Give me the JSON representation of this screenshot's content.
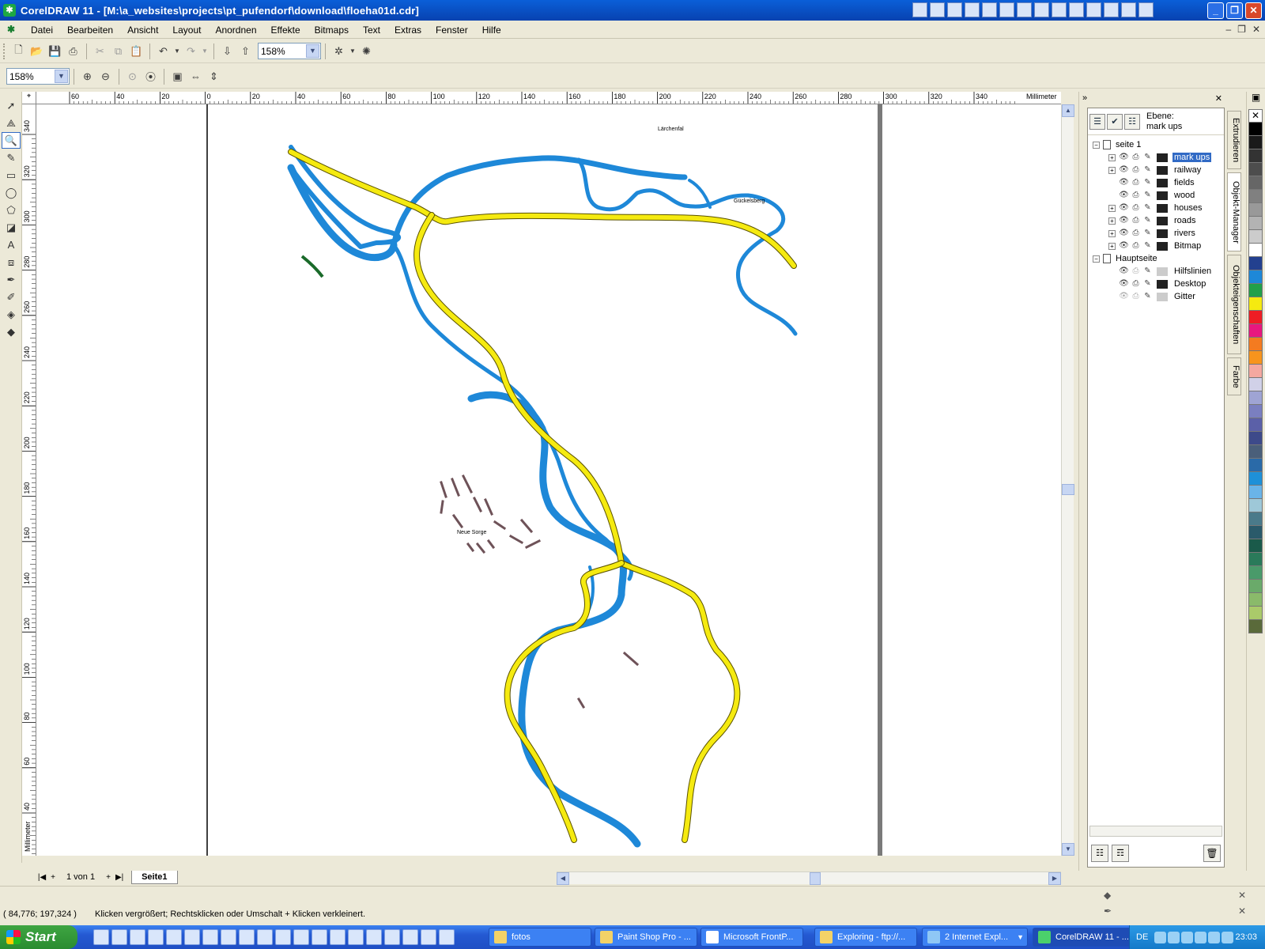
{
  "window": {
    "title": "CorelDRAW 11 - [M:\\a_websites\\projects\\pt_pufendorf\\download\\floeha01d.cdr]",
    "app_icon": "coreldraw-balloon-icon"
  },
  "menu": [
    "Datei",
    "Bearbeiten",
    "Ansicht",
    "Layout",
    "Anordnen",
    "Effekte",
    "Bitmaps",
    "Text",
    "Extras",
    "Fenster",
    "Hilfe"
  ],
  "toolbar": {
    "zoom_standard": "158%",
    "zoom_toolbar": "158%"
  },
  "ruler": {
    "unit": "Millimeter",
    "h_ticks": [
      "60",
      "40",
      "20",
      "0",
      "20",
      "40",
      "60",
      "80",
      "100",
      "120",
      "140",
      "160",
      "180",
      "200",
      "220",
      "240",
      "260",
      "280",
      "300",
      "320",
      "340"
    ],
    "v_ticks": [
      "340",
      "320",
      "300",
      "280",
      "260",
      "240",
      "220",
      "200",
      "180",
      "160",
      "140",
      "120",
      "100",
      "80",
      "60",
      "40"
    ]
  },
  "map_labels": {
    "label1": "Lärchenfal",
    "label2": "Gückelsberg",
    "label3": "Neue Sorge"
  },
  "colors": {
    "river": "#1e88d8",
    "road": "#f5ea10",
    "houses": "#6e5258"
  },
  "page_nav": {
    "count": "1 von 1",
    "tab": "Seite1"
  },
  "docker": {
    "ebene_label": "Ebene:",
    "ebene_value": "mark ups",
    "page": "seite 1",
    "layers": [
      "mark ups",
      "railway",
      "fields",
      "wood",
      "houses",
      "roads",
      "rivers",
      "Bitmap"
    ],
    "master": "Hauptseite",
    "master_layers": [
      "Hilfslinien",
      "Desktop",
      "Gitter"
    ],
    "side_tabs": [
      "Extrudieren",
      "Objekt-Manager",
      "Objekteigenschaften",
      "Farbe"
    ]
  },
  "status": {
    "coords": "( 84,776; 197,324 )",
    "hint": "Klicken vergrößert; Rechtsklicken oder Umschalt + Klicken verkleinert."
  },
  "taskbar": {
    "start": "Start",
    "tasks": [
      "fotos",
      "Paint Shop Pro - ...",
      "Microsoft FrontP...",
      "Exploring - ftp://...",
      "2 Internet Expl...",
      "CorelDRAW 11 - ..."
    ],
    "lang": "DE",
    "clock": "23:03"
  },
  "palette": [
    "#ffffff",
    "#000000",
    "#1a1a1a",
    "#333333",
    "#4d4d4d",
    "#666666",
    "#808080",
    "#999999",
    "#b3b3b3",
    "#cccccc",
    "#ffffff",
    "#23408f",
    "#1e88d8",
    "#22a04a",
    "#f5ea10",
    "#ee1d24",
    "#e8177f",
    "#f47b20",
    "#f7941d",
    "#f4a8a0",
    "#d1d1e8",
    "#9fa4d4",
    "#7a7fc0",
    "#5b60a8",
    "#3d4a8a",
    "#4a5f7a",
    "#2a6aa8",
    "#1e90d8",
    "#6ab4e8",
    "#9ec8d8",
    "#4a7a8a",
    "#2a5a6a",
    "#1a5a4a",
    "#2a7a5a",
    "#4a9a6a",
    "#6aaa6a",
    "#8aba6a",
    "#aaca6a",
    "#5a6a3a"
  ]
}
